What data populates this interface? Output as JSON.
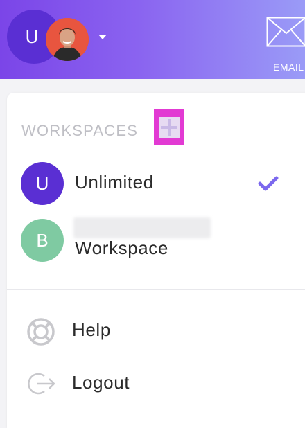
{
  "header": {
    "user_initial": "U",
    "email_label": "EMAIL"
  },
  "workspaces": {
    "title": "WORKSPACES",
    "items": [
      {
        "initial": "U",
        "name": "Unlimited",
        "selected": true,
        "color": "#5a2fd3"
      },
      {
        "initial": "B",
        "name": "Workspace",
        "color": "#7fcaa2"
      }
    ]
  },
  "menu": {
    "help_label": "Help",
    "logout_label": "Logout"
  },
  "colors": {
    "accent": "#7b45e8",
    "highlight": "#e23ad3",
    "check": "#7b68ee"
  }
}
